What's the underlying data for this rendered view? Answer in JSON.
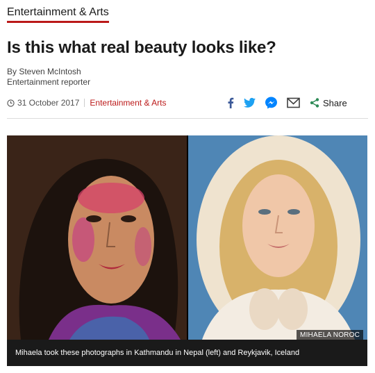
{
  "section": {
    "label": "Entertainment & Arts"
  },
  "article": {
    "headline": "Is this what real beauty looks like?",
    "author": "By Steven McIntosh",
    "author_role": "Entertainment reporter",
    "date": "31 October 2017",
    "category": "Entertainment & Arts"
  },
  "share": {
    "label": "Share",
    "icons": [
      "facebook-icon",
      "twitter-icon",
      "messenger-icon",
      "email-icon",
      "share-icon"
    ]
  },
  "figure": {
    "credit": "MIHAELA NOROC",
    "caption": "Mihaela took these photographs in Kathmandu in Nepal (left) and Reykjavik, Iceland"
  },
  "colors": {
    "accent": "#bb1919",
    "facebook": "#3b5998",
    "twitter": "#1da1f2",
    "messenger": "#0084ff",
    "share_green": "#2e8b57"
  }
}
